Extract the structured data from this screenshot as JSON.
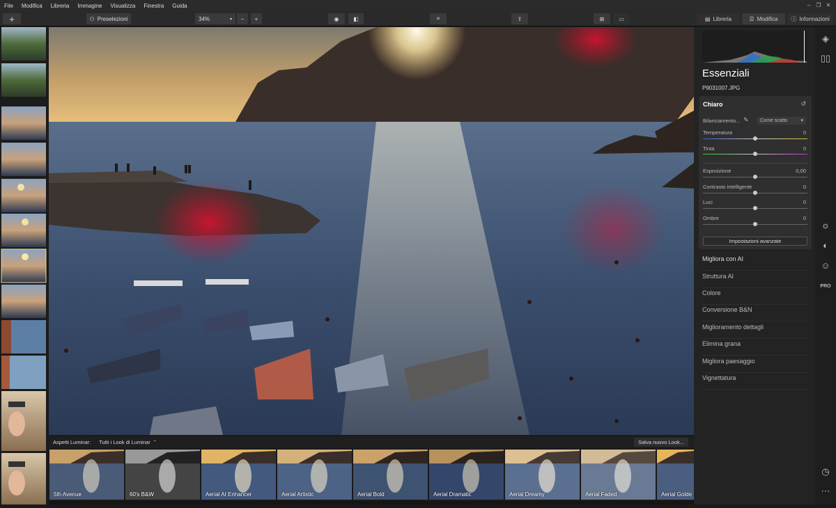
{
  "menu": [
    "File",
    "Modifica",
    "Libreria",
    "Immagine",
    "Visualizza",
    "Finestra",
    "Guida"
  ],
  "toolbar": {
    "add_label": "+",
    "presets_label": "Preselezioni",
    "zoom_value": "34%",
    "zoom_minus": "−",
    "zoom_plus": "+",
    "tabs": {
      "library": "Libreria",
      "edit": "Modifica",
      "info": "Informazioni"
    }
  },
  "panel": {
    "title": "Essenziali",
    "filename": "P9031007.JPG",
    "card": {
      "title": "Chiaro",
      "white_balance_label": "Bilanciamento...",
      "white_balance_value": "Come scatto",
      "sliders": [
        {
          "label": "Temperatura",
          "value": "0",
          "pos": 0.5
        },
        {
          "label": "Tinta",
          "value": "0",
          "pos": 0.5
        },
        {
          "label": "Esposizione",
          "value": "0,00",
          "pos": 0.5
        },
        {
          "label": "Contrasto intelligente",
          "value": "0",
          "pos": 0.5
        },
        {
          "label": "Luci",
          "value": "0",
          "pos": 0.5
        },
        {
          "label": "Ombre",
          "value": "0",
          "pos": 0.5
        }
      ],
      "advanced_label": "Impostazioni avanzate"
    },
    "tools": [
      "Migliora con AI",
      "Struttura AI",
      "Colore",
      "Conversione B&N",
      "Miglioramento dettagli",
      "Elimina grana",
      "Migliora paesaggio",
      "Vignettatura"
    ]
  },
  "icons": {
    "layers": "layers-icon",
    "compare": "compare-icon",
    "essentials": "sun-icon",
    "creative": "palette-icon",
    "portrait": "face-icon",
    "pro": "PRO",
    "history": "clock-icon",
    "more": "more-icon"
  },
  "looks_bar": {
    "label": "Aspetti Luminar:",
    "filter": "Tutti i Look di Luminar",
    "save": "Salva nuovo Look..."
  },
  "looks": [
    "5th Avenue",
    "60's B&W",
    "Aerial AI Enhancer",
    "Aerial Artistic",
    "Aerial Bold",
    "Aerial Dramatic",
    "Aerial Dreamy",
    "Aerial Faded",
    "Aerial Golde"
  ]
}
